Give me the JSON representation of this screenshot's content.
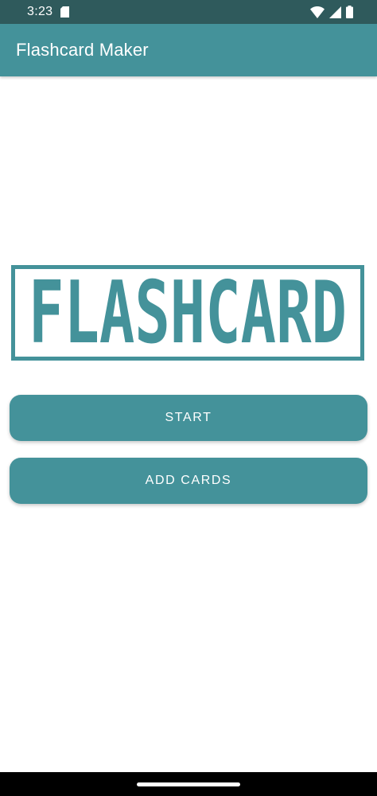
{
  "status_bar": {
    "time": "3:23",
    "icons": [
      "sd-card-icon",
      "wifi-icon",
      "cell-signal-icon",
      "battery-icon"
    ]
  },
  "app_bar": {
    "title": "Flashcard Maker"
  },
  "logo": {
    "text": "FLASHCARD"
  },
  "buttons": {
    "start": "START",
    "add_cards": "ADD CARDS"
  },
  "colors": {
    "status_bar": "#2f5a5c",
    "accent": "#44929a",
    "background": "#ffffff",
    "nav_bar": "#000000"
  }
}
